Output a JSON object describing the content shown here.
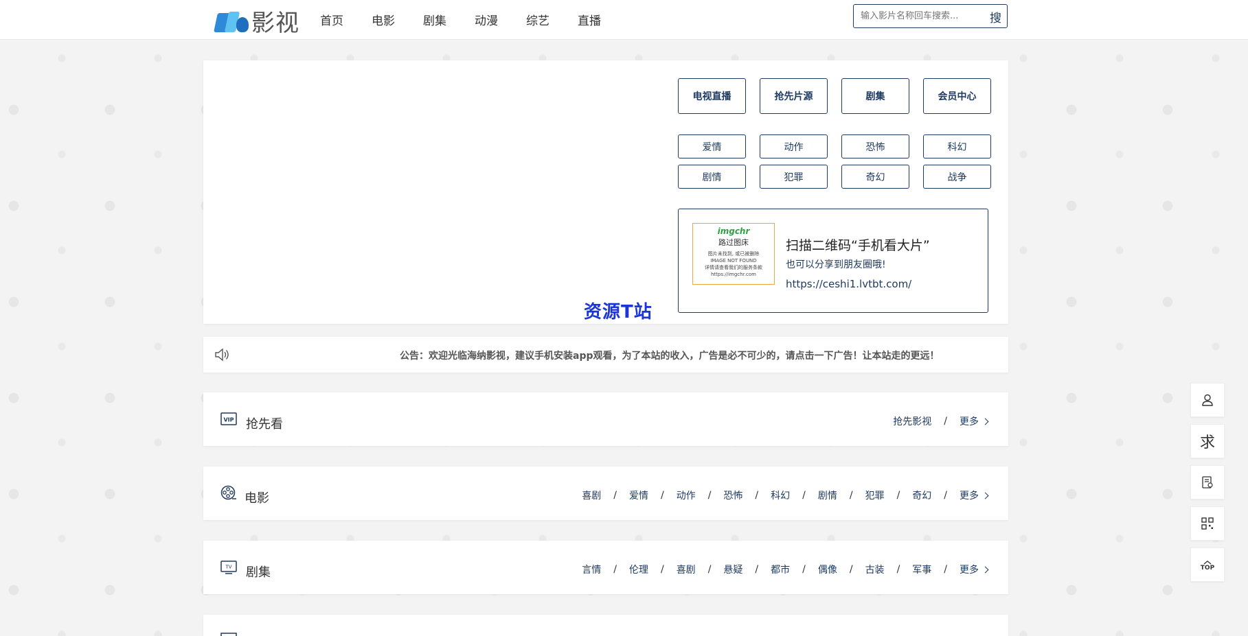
{
  "header": {
    "logo_text": "影视",
    "nav": [
      "首页",
      "电影",
      "剧集",
      "动漫",
      "综艺",
      "直播"
    ],
    "search_placeholder": "输入影片名称回车搜索...",
    "search_button": "搜"
  },
  "hero": {
    "watermark": "资源T站",
    "big_buttons": [
      "电视直播",
      "抢先片源",
      "剧集",
      "会员中心"
    ],
    "genre_buttons": [
      "爱情",
      "动作",
      "恐怖",
      "科幻",
      "剧情",
      "犯罪",
      "奇幻",
      "战争"
    ],
    "qr": {
      "img_brand": "imgchr",
      "img_title": "路过图床",
      "img_line1": "图片未找到, 或已被删除",
      "img_line2": "IMAGE NOT FOUND",
      "img_line3": "详情请查看我们的服务条款",
      "img_line4": "https://imgchr.com",
      "title": "扫描二维码“手机看大片”",
      "subtitle": "也可以分享到朋友圈哦!",
      "url": "https://ceshi1.lvtbt.com/"
    }
  },
  "notice": {
    "text": "公告：欢迎光临海纳影视，建议手机安装app观看，为了本站的收入，广告是必不可少的，请点击一下广告！让本站走的更远！"
  },
  "sections": [
    {
      "title": "抢先看",
      "icon": "vip-icon",
      "links": [
        "抢先影视"
      ],
      "more": "更多"
    },
    {
      "title": "电影",
      "icon": "film-reel-icon",
      "links": [
        "喜剧",
        "爱情",
        "动作",
        "恐怖",
        "科幻",
        "剧情",
        "犯罪",
        "奇幻"
      ],
      "more": "更多"
    },
    {
      "title": "剧集",
      "icon": "tv-icon",
      "links": [
        "言情",
        "伦理",
        "喜剧",
        "悬疑",
        "都市",
        "偶像",
        "古装",
        "军事"
      ],
      "more": "更多"
    }
  ],
  "sidebar": {
    "buttons": [
      "user-icon",
      "求",
      "feedback-icon",
      "qrcode-icon",
      "TOP"
    ]
  }
}
